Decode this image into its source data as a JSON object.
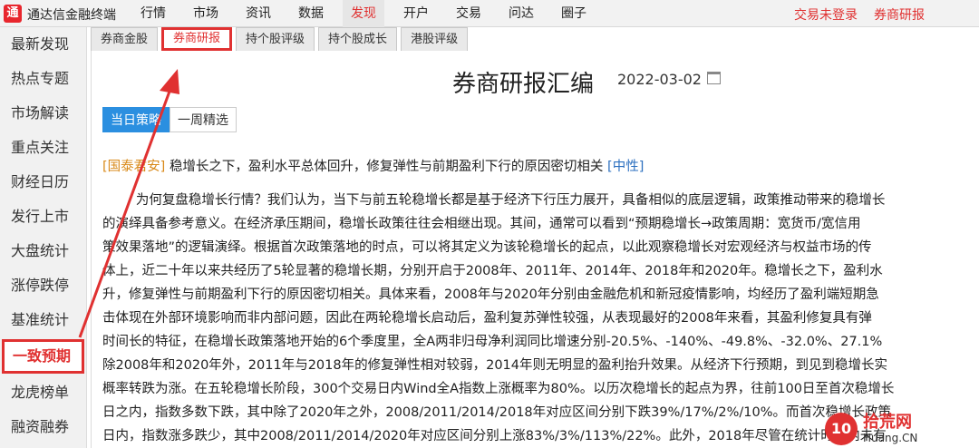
{
  "app": {
    "title": "通达信金融终端",
    "logo_glyph": "通"
  },
  "menu": [
    "行情",
    "市场",
    "资讯",
    "数据",
    "发现",
    "开户",
    "交易",
    "问达",
    "圈子"
  ],
  "menu_active": "发现",
  "top_right": {
    "login": "交易未登录",
    "research": "券商研报"
  },
  "sidebar": [
    "最新发现",
    "热点专题",
    "市场解读",
    "重点关注",
    "财经日历",
    "发行上市",
    "大盘统计",
    "涨停跌停",
    "基准统计",
    "一致预期",
    "龙虎榜单",
    "融资融券"
  ],
  "sidebar_active": "一致预期",
  "tabs": [
    "券商金股",
    "券商研报",
    "持个股评级",
    "持个股成长",
    "港股评级"
  ],
  "tab_active": "券商研报",
  "page": {
    "heading": "券商研报汇编",
    "date": "2022-03-02"
  },
  "subtabs": [
    "当日策略",
    "一周精选"
  ],
  "summary": {
    "source": "[国泰君安]",
    "title": "稳增长之下，盈利水平总体回升，修复弹性与前期盈利下行的原因密切相关",
    "tag": "[中性]"
  },
  "body_lines": [
    "        为何复盘稳增长行情？我们认为，当下与前五轮稳增长都是基于经济下行压力展开，具备相似的底层逻辑，政策推动带来的稳增长",
    "的演绎具备参考意义。在经济承压期间，稳增长政策往往会相继出现。其间，通常可以看到“预期稳增长→政策周期：宽货币/宽信用",
    "策效果落地”的逻辑演绎。根据首次政策落地的时点，可以将其定义为该轮稳增长的起点，以此观察稳增长对宏观经济与权益市场的传",
    "体上，近二十年以来共经历了5轮显著的稳增长期，分别开启于2008年、2011年、2014年、2018年和2020年。稳增长之下，盈利水",
    "升，修复弹性与前期盈利下行的原因密切相关。具体来看，2008年与2020年分别由金融危机和新冠疫情影响，均经历了盈利端短期急",
    "击体现在外部环境影响而非内部问题，因此在两轮稳增长启动后，盈利复苏弹性较强，从表现最好的2008年来看，其盈利修复具有弹",
    "时间长的特征，在稳增长政策落地开始的6个季度里，全A两非归母净利润同比增速分别-20.5%、-140%、-49.8%、-32.0%、27.1%",
    "除2008年和2020年外，2011年与2018年的修复弹性相对较弱，2014年则无明显的盈利抬升效果。从经济下行预期，到见到稳增长实",
    "概率转跌为涨。在五轮稳增长阶段，300个交易日内Wind全A指数上涨概率为80%。以历次稳增长的起点为界，往前100日至首次稳增长",
    "日之内，指数多数下跌，其中除了2020年之外，2008/2011/2014/2018年对应区间分别下跌39%/17%/2%/10%。而首次稳增长政策",
    "日内，指数涨多跌少，其中2008/2011/2014/2020年对应区间分别上涨83%/3%/113%/22%。此外，2018年尽管在统计时段内未有"
  ],
  "watermark": {
    "logo": "10",
    "cn": "拾荒网",
    "url": "Huang.CN"
  },
  "colors": {
    "accent": "#e03131",
    "blue": "#2b8fe0"
  }
}
